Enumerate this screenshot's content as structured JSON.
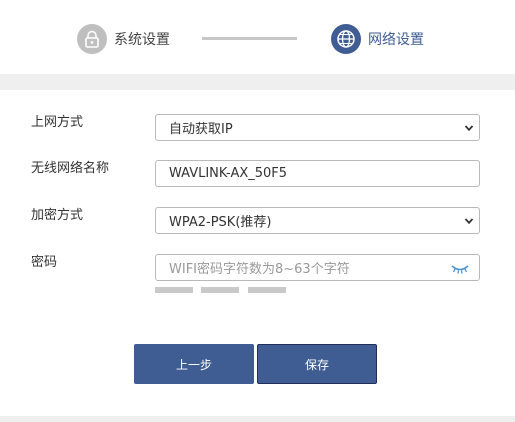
{
  "stepper": {
    "steps": [
      {
        "label": "系统设置",
        "icon": "lock-icon",
        "state": "done"
      },
      {
        "label": "网络设置",
        "icon": "globe-icon",
        "state": "active"
      }
    ]
  },
  "form": {
    "connection_type": {
      "label": "上网方式",
      "value": "自动获取IP"
    },
    "ssid": {
      "label": "无线网络名称",
      "value": "WAVLINK-AX_50F5"
    },
    "encryption": {
      "label": "加密方式",
      "value": "WPA2-PSK(推荐)"
    },
    "password": {
      "label": "密码",
      "placeholder": "WIFI密码字符数为8~63个字符",
      "value": "",
      "toggle_icon": "eye-closed-icon"
    }
  },
  "buttons": {
    "prev_label": "上一步",
    "save_label": "保存"
  },
  "colors": {
    "accent": "#3f5c93",
    "inactive": "#bfbfbf"
  }
}
